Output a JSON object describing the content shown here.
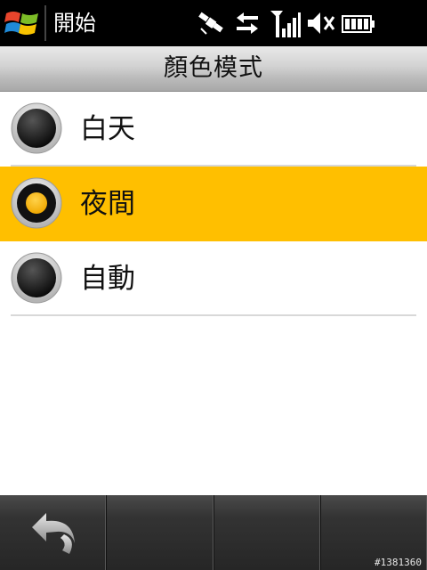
{
  "statusbar": {
    "start_label": "開始",
    "icons": [
      "windows-logo-icon",
      "gps-satellite-icon",
      "data-transfer-icon",
      "signal-strength-icon",
      "speaker-muted-icon",
      "battery-icon"
    ]
  },
  "titlebar": {
    "title": "顏色模式"
  },
  "options": [
    {
      "label": "白天",
      "selected": false
    },
    {
      "label": "夜間",
      "selected": true
    },
    {
      "label": "自動",
      "selected": false
    }
  ],
  "colors": {
    "highlight": "#ffbf00",
    "titlebar": "#c8c8c8",
    "statusbar": "#000000",
    "softbar": "#333333"
  },
  "softbar": {
    "back_icon": "back-arrow-icon"
  },
  "watermark": "#1381360"
}
